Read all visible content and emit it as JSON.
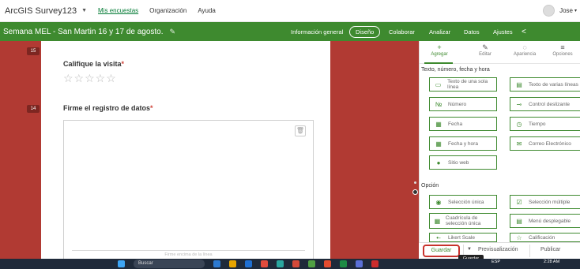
{
  "topbar": {
    "app_title": "ArcGIS Survey123",
    "nav": [
      "Mis encuestas",
      "Organización",
      "Ayuda"
    ],
    "user": "Jose"
  },
  "header": {
    "survey_title": "Semana MEL - San Martin 16 y 17 de agosto.",
    "nav": [
      "Información general",
      "Diseño",
      "Colaborar",
      "Analizar",
      "Datos",
      "Ajustes"
    ],
    "active": "Diseño"
  },
  "form": {
    "q15": {
      "number": "15",
      "title": "Califique la visita",
      "required": "*"
    },
    "q14": {
      "number": "14",
      "title": "Firme el registro de datos",
      "required": "*",
      "signature_label": "Firme encima de la línea"
    }
  },
  "panel": {
    "tabs": [
      {
        "icon": "+",
        "label": "Agregar"
      },
      {
        "icon": "✎",
        "label": "Editar"
      },
      {
        "icon": "◌",
        "label": "Apariencia"
      },
      {
        "icon": "≡",
        "label": "Opciones"
      }
    ],
    "section_text": "Texto, número, fecha y hora",
    "fields_text": [
      {
        "icon": "▭",
        "label": "Texto de una sola línea"
      },
      {
        "icon": "▤",
        "label": "Texto de varias líneas"
      },
      {
        "icon": "№",
        "label": "Número"
      },
      {
        "icon": "⊸",
        "label": "Control deslizante"
      },
      {
        "icon": "▦",
        "label": "Fecha"
      },
      {
        "icon": "◷",
        "label": "Tiempo"
      },
      {
        "icon": "▦",
        "label": "Fecha y hora"
      },
      {
        "icon": "✉",
        "label": "Correo Electrónico"
      },
      {
        "icon": "●",
        "label": "Sitio web"
      }
    ],
    "section_choice": "Opción",
    "fields_choice": [
      {
        "icon": "◉",
        "label": "Selección única"
      },
      {
        "icon": "☑",
        "label": "Selección múltiple"
      },
      {
        "icon": "▦",
        "label": "Cuadrícula de selección única"
      },
      {
        "icon": "▤",
        "label": "Menú desplegable"
      },
      {
        "icon": "•-",
        "label": "Likert Scale"
      },
      {
        "icon": "☆",
        "label": "Calificación"
      }
    ],
    "footer": {
      "save": "Guardar",
      "preview": "Previsualización",
      "publish": "Publicar",
      "tooltip": "Guardar"
    }
  },
  "taskbar": {
    "search": "Buscar",
    "lang": "ESP",
    "time": "2:28 AM"
  },
  "colors": {
    "brand_green": "#3e8a2f",
    "canvas_red": "#b13a33",
    "save_border": "#c8322d"
  }
}
